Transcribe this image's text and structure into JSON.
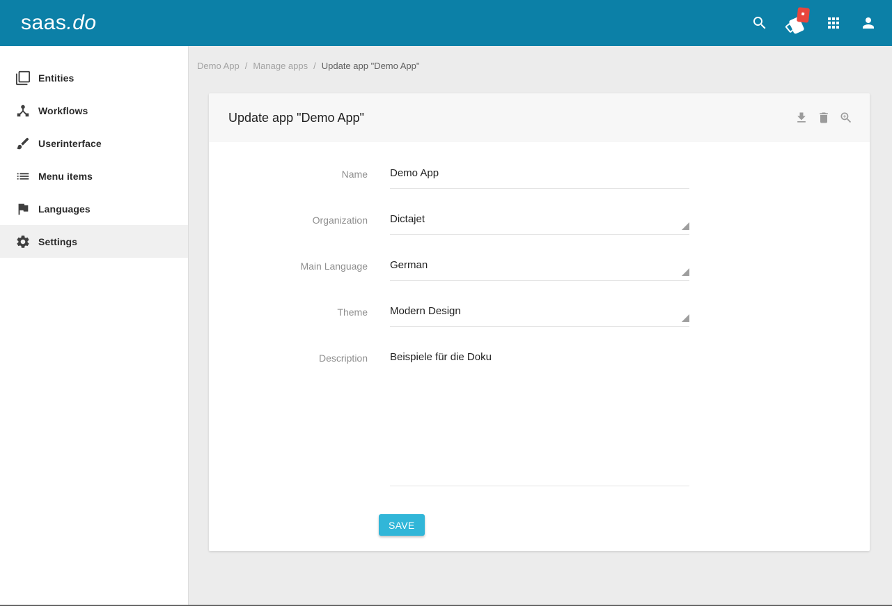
{
  "app": {
    "logo_prefix": "saas",
    "logo_suffix": ".do"
  },
  "topbar": {
    "icons": [
      {
        "name": "search-icon"
      },
      {
        "name": "notifications-icon",
        "badge": true
      },
      {
        "name": "apps-grid-icon"
      },
      {
        "name": "account-icon"
      }
    ]
  },
  "sidebar": {
    "items": [
      {
        "icon": "entities-icon",
        "label": "Entities",
        "active": false
      },
      {
        "icon": "workflows-icon",
        "label": "Workflows",
        "active": false
      },
      {
        "icon": "userinterface-icon",
        "label": "Userinterface",
        "active": false
      },
      {
        "icon": "menu-items-icon",
        "label": "Menu items",
        "active": false
      },
      {
        "icon": "languages-icon",
        "label": "Languages",
        "active": false
      },
      {
        "icon": "settings-icon",
        "label": "Settings",
        "active": true
      }
    ]
  },
  "breadcrumb": {
    "separator": "/",
    "items": [
      {
        "label": "Demo App",
        "current": false
      },
      {
        "label": "Manage apps",
        "current": false
      },
      {
        "label": "Update app \"Demo App\"",
        "current": true
      }
    ]
  },
  "card": {
    "title": "Update app \"Demo App\"",
    "actions": [
      {
        "icon": "download-icon"
      },
      {
        "icon": "delete-icon"
      },
      {
        "icon": "zoom-in-icon"
      }
    ],
    "form": {
      "fields": [
        {
          "label": "Name",
          "value": "Demo App",
          "type": "text"
        },
        {
          "label": "Organization",
          "value": "Dictajet",
          "type": "select"
        },
        {
          "label": "Main Language",
          "value": "German",
          "type": "select"
        },
        {
          "label": "Theme",
          "value": "Modern Design",
          "type": "select"
        },
        {
          "label": "Description",
          "value": "Beispiele für die Doku",
          "type": "textarea"
        }
      ],
      "save_label": "SAVE"
    }
  },
  "colors": {
    "topbar": "#0c80a7",
    "accent": "#31b6d8",
    "badge": "#e8463d",
    "content_bg": "#ececec",
    "card_header_bg": "#f7f7f7",
    "active_item_bg": "#f0f0f0"
  }
}
